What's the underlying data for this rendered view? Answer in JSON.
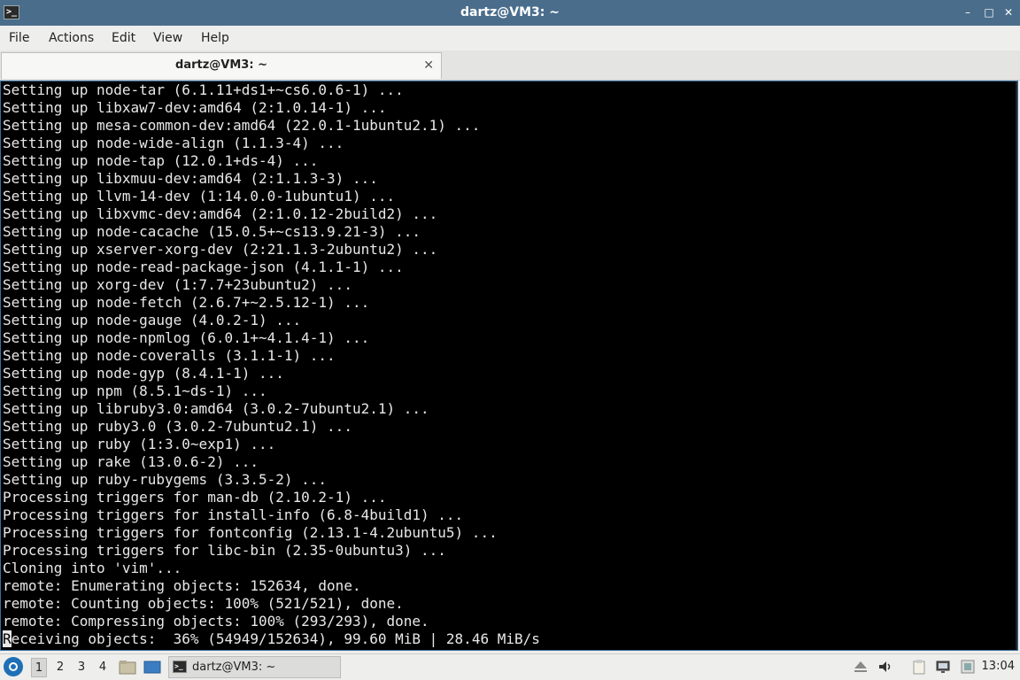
{
  "window": {
    "title": "dartz@VM3: ~",
    "icon": "terminal-icon",
    "controls": {
      "minimize": "–",
      "maximize": "□",
      "close": "✕"
    }
  },
  "menubar": {
    "items": [
      "File",
      "Actions",
      "Edit",
      "View",
      "Help"
    ]
  },
  "tab": {
    "label": "dartz@VM3: ~",
    "close": "✕"
  },
  "terminal": {
    "lines": [
      "Setting up node-tar (6.1.11+ds1+~cs6.0.6-1) ...",
      "Setting up libxaw7-dev:amd64 (2:1.0.14-1) ...",
      "Setting up mesa-common-dev:amd64 (22.0.1-1ubuntu2.1) ...",
      "Setting up node-wide-align (1.1.3-4) ...",
      "Setting up node-tap (12.0.1+ds-4) ...",
      "Setting up libxmuu-dev:amd64 (2:1.1.3-3) ...",
      "Setting up llvm-14-dev (1:14.0.0-1ubuntu1) ...",
      "Setting up libxvmc-dev:amd64 (2:1.0.12-2build2) ...",
      "Setting up node-cacache (15.0.5+~cs13.9.21-3) ...",
      "Setting up xserver-xorg-dev (2:21.1.3-2ubuntu2) ...",
      "Setting up node-read-package-json (4.1.1-1) ...",
      "Setting up xorg-dev (1:7.7+23ubuntu2) ...",
      "Setting up node-fetch (2.6.7+~2.5.12-1) ...",
      "Setting up node-gauge (4.0.2-1) ...",
      "Setting up node-npmlog (6.0.1+~4.1.4-1) ...",
      "Setting up node-coveralls (3.1.1-1) ...",
      "Setting up node-gyp (8.4.1-1) ...",
      "Setting up npm (8.5.1~ds-1) ...",
      "Setting up libruby3.0:amd64 (3.0.2-7ubuntu2.1) ...",
      "Setting up ruby3.0 (3.0.2-7ubuntu2.1) ...",
      "Setting up ruby (1:3.0~exp1) ...",
      "Setting up rake (13.0.6-2) ...",
      "Setting up ruby-rubygems (3.3.5-2) ...",
      "Processing triggers for man-db (2.10.2-1) ...",
      "Processing triggers for install-info (6.8-4build1) ...",
      "Processing triggers for fontconfig (2.13.1-4.2ubuntu5) ...",
      "Processing triggers for libc-bin (2.35-0ubuntu3) ...",
      "Cloning into 'vim'...",
      "remote: Enumerating objects: 152634, done.",
      "remote: Counting objects: 100% (521/521), done.",
      "remote: Compressing objects: 100% (293/293), done."
    ],
    "last_line_cursor": "R",
    "last_line_rest": "eceiving objects:  36% (54949/152634), 99.60 MiB | 28.46 MiB/s"
  },
  "taskbar": {
    "start_icon": "start-menu-icon",
    "workspaces": [
      "1",
      "2",
      "3",
      "4"
    ],
    "active_workspace": "1",
    "launchers": [
      "file-manager-icon",
      "desktop-icon"
    ],
    "task_label": "dartz@VM3: ~",
    "tray_icons": [
      "eject-icon",
      "volume-icon",
      "clipboard-icon",
      "network-icon",
      "update-icon"
    ],
    "clock": "13:04"
  }
}
